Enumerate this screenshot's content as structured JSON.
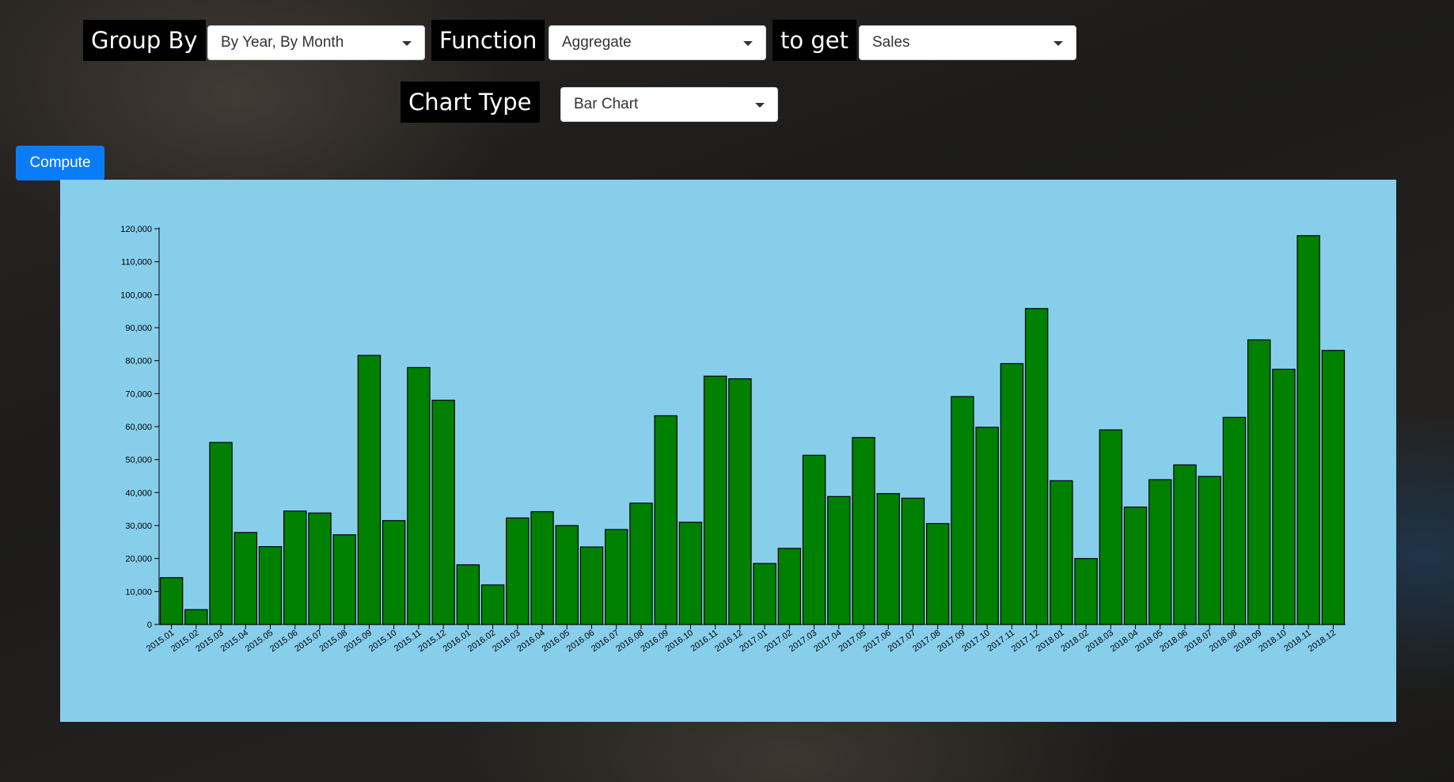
{
  "controls": {
    "group_by_label": "Group By",
    "group_by_value": "By Year, By Month",
    "function_label": "Function",
    "function_value": "Aggregate",
    "to_get_label": "to get",
    "to_get_value": "Sales",
    "chart_type_label": "Chart Type",
    "chart_type_value": "Bar Chart",
    "compute_label": "Compute"
  },
  "colors": {
    "bar": "#008000",
    "panel": "#87ceeb",
    "button": "#0a7cf7"
  },
  "chart_data": {
    "type": "bar",
    "title": "",
    "xlabel": "",
    "ylabel": "",
    "ylim": [
      0,
      120000
    ],
    "yticks": [
      0,
      10000,
      20000,
      30000,
      40000,
      50000,
      60000,
      70000,
      80000,
      90000,
      100000,
      110000,
      120000
    ],
    "ytick_labels": [
      "0",
      "10,000",
      "20,000",
      "30,000",
      "40,000",
      "50,000",
      "60,000",
      "70,000",
      "80,000",
      "90,000",
      "100,000",
      "110,000",
      "120,000"
    ],
    "grid": false,
    "categories": [
      "2015.01",
      "2015.02",
      "2015.03",
      "2015.04",
      "2015.05",
      "2015.06",
      "2015.07",
      "2015.08",
      "2015.09",
      "2015.10",
      "2015.11",
      "2015.12",
      "2016.01",
      "2016.02",
      "2016.03",
      "2016.04",
      "2016.05",
      "2016.06",
      "2016.07",
      "2016.08",
      "2016.09",
      "2016.10",
      "2016.11",
      "2016.12",
      "2017.01",
      "2017.02",
      "2017.03",
      "2017.04",
      "2017.05",
      "2017.06",
      "2017.07",
      "2017.08",
      "2017.09",
      "2017.10",
      "2017.11",
      "2017.12",
      "2018.01",
      "2018.02",
      "2018.03",
      "2018.04",
      "2018.05",
      "2018.06",
      "2018.07",
      "2018.08",
      "2018.09",
      "2018.10",
      "2018.11",
      "2018.12"
    ],
    "values": [
      14200,
      4500,
      55200,
      27900,
      23600,
      34400,
      33800,
      27200,
      81600,
      31500,
      77900,
      68000,
      18100,
      12000,
      32300,
      34200,
      30000,
      23500,
      28800,
      36800,
      63300,
      31000,
      75300,
      74500,
      18500,
      23100,
      51300,
      38800,
      56700,
      39700,
      38300,
      30600,
      69100,
      59800,
      79100,
      95800,
      43600,
      20000,
      59000,
      35600,
      43900,
      48400,
      44900,
      62800,
      86300,
      77400,
      117900,
      83100
    ]
  }
}
